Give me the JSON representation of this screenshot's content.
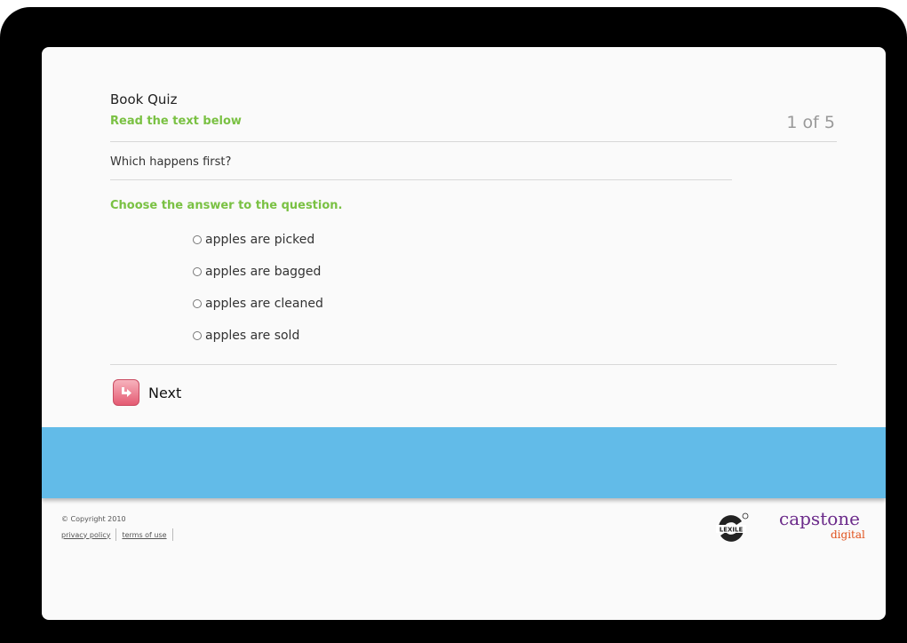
{
  "quiz": {
    "title": "Book Quiz",
    "instruction": "Read the text below",
    "progress": "1 of 5",
    "question": "Which happens first?",
    "prompt": "Choose the answer to the question.",
    "options": [
      {
        "label": "apples are picked",
        "selected": false
      },
      {
        "label": "apples are bagged",
        "selected": false
      },
      {
        "label": "apples are cleaned",
        "selected": false
      },
      {
        "label": "apples are sold",
        "selected": false
      }
    ],
    "next_label": "Next"
  },
  "footer": {
    "copyright": "© Copyright 2010",
    "privacy_link": "privacy policy",
    "terms_link": "terms of use",
    "lexile_logo_text": "LEXILE",
    "brand_name": "capstone",
    "brand_sub": "digital"
  },
  "colors": {
    "accent_green": "#7ac143",
    "banner_blue": "#62bbe8",
    "next_button_pink": "#e45a72",
    "brand_purple": "#6b2a8a",
    "brand_orange": "#e0501b"
  },
  "icons": {
    "next": "next-arrow-icon",
    "radio": "radio-icon",
    "lexile": "lexile-logo"
  }
}
